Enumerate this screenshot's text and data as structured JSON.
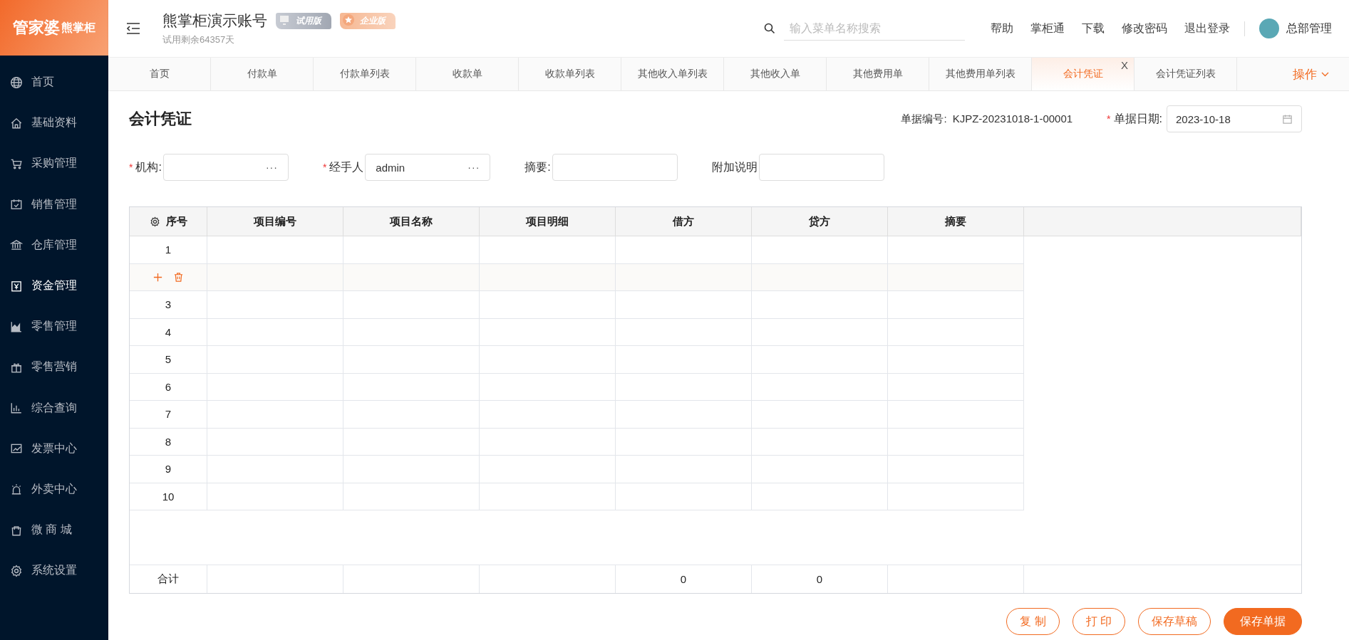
{
  "logo": {
    "brand": "管家婆",
    "product": "熊掌柜"
  },
  "header": {
    "account": "熊掌柜演示账号",
    "badges": [
      {
        "kind": "trial",
        "label": "试用版"
      },
      {
        "kind": "enterprise",
        "label": "企业版"
      }
    ],
    "trial_note": "试用剩余64357天",
    "search": {
      "placeholder": "输入菜单名称搜索"
    },
    "links": [
      "帮助",
      "掌柜通",
      "下载",
      "修改密码",
      "退出登录"
    ],
    "user": "总部管理"
  },
  "sidebar": {
    "items": [
      {
        "label": "首页",
        "selected": false
      },
      {
        "label": "基础资料",
        "selected": false
      },
      {
        "label": "采购管理",
        "selected": false
      },
      {
        "label": "销售管理",
        "selected": false
      },
      {
        "label": "仓库管理",
        "selected": false
      },
      {
        "label": "资金管理",
        "selected": true
      },
      {
        "label": "零售管理",
        "selected": false
      },
      {
        "label": "零售营销",
        "selected": false
      },
      {
        "label": "综合查询",
        "selected": false
      },
      {
        "label": "发票中心",
        "selected": false
      },
      {
        "label": "外卖中心",
        "selected": false
      },
      {
        "label": "微 商 城",
        "selected": false
      },
      {
        "label": "系统设置",
        "selected": false
      }
    ]
  },
  "tabs": [
    {
      "label": "首页",
      "selected": false
    },
    {
      "label": "付款单",
      "selected": false
    },
    {
      "label": "付款单列表",
      "selected": false
    },
    {
      "label": "收款单",
      "selected": false
    },
    {
      "label": "收款单列表",
      "selected": false
    },
    {
      "label": "其他收入单列表",
      "selected": false
    },
    {
      "label": "其他收入单",
      "selected": false
    },
    {
      "label": "其他费用单",
      "selected": false
    },
    {
      "label": "其他费用单列表",
      "selected": false
    },
    {
      "label": "会计凭证",
      "selected": true
    },
    {
      "label": "会计凭证列表",
      "selected": false
    }
  ],
  "tab_close": "X",
  "operations": "操作",
  "page_title": "会计凭证",
  "doc_number": {
    "label": "单据编号:",
    "value": "KJPZ-20231018-1-00001"
  },
  "doc_date": {
    "label": "单据日期:",
    "value": "2023-10-18",
    "required": true
  },
  "required_mark": "*",
  "picker_glyph": "···",
  "fields": [
    {
      "label": "机构:",
      "required": true,
      "picker": true
    },
    {
      "label": "经手人",
      "value": "admin",
      "required": true,
      "picker": true
    },
    {
      "label": "摘要:",
      "required": false,
      "picker": false
    },
    {
      "label": "附加说明",
      "required": false,
      "picker": false
    }
  ],
  "table": {
    "columns": [
      "序号",
      "项目编号",
      "项目名称",
      "项目明细",
      "借方",
      "贷方",
      "摘要"
    ],
    "rows": [
      {
        "kind": "number",
        "no": "1"
      },
      {
        "kind": "actions"
      },
      {
        "kind": "number",
        "no": "3"
      },
      {
        "kind": "number",
        "no": "4"
      },
      {
        "kind": "number",
        "no": "5"
      },
      {
        "kind": "number",
        "no": "6"
      },
      {
        "kind": "number",
        "no": "7"
      },
      {
        "kind": "number",
        "no": "8"
      },
      {
        "kind": "number",
        "no": "9"
      },
      {
        "kind": "number",
        "no": "10"
      }
    ],
    "total": {
      "label": "合计",
      "debit": "0",
      "credit": "0"
    }
  },
  "buttons": [
    {
      "kind": "outline",
      "label": "复 制"
    },
    {
      "kind": "outline",
      "label": "打 印"
    },
    {
      "kind": "outline",
      "label": "保存草稿"
    },
    {
      "kind": "primary",
      "label": "保存单据"
    }
  ]
}
